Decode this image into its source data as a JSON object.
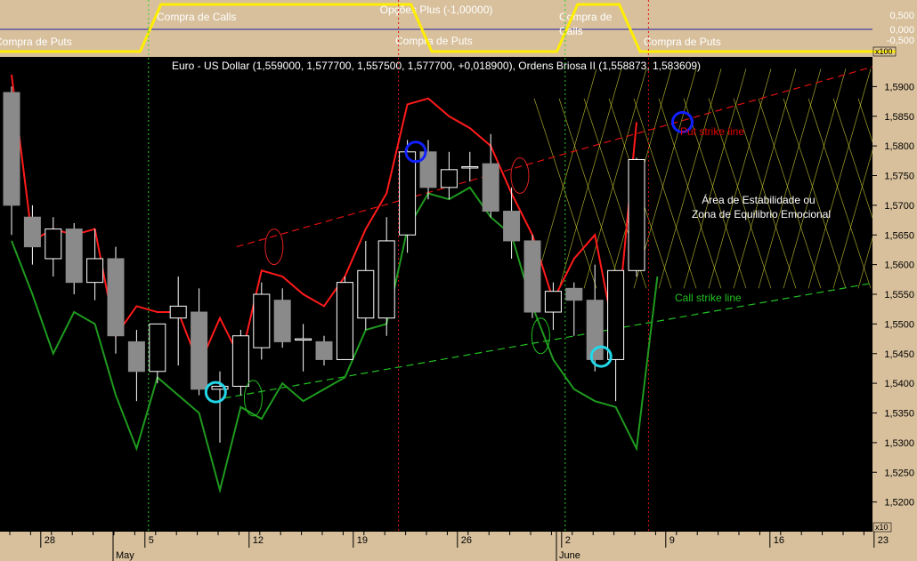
{
  "top_panel": {
    "title": "Opções Plus (-1,00000)",
    "labels": [
      {
        "text": "Compra de Puts"
      },
      {
        "text": "Compra de Calls"
      },
      {
        "text": "Compra de Puts"
      },
      {
        "text": "Compra de"
      },
      {
        "text": "Calls"
      },
      {
        "text": "Compra de Puts"
      }
    ],
    "y_ticks": [
      "0,500",
      "0,000",
      "-0,500"
    ],
    "unit": "x100",
    "signal": [
      {
        "from": 0,
        "to": 6,
        "value": -0.5
      },
      {
        "from": 7,
        "to": 19,
        "value": 0.5
      },
      {
        "from": 20,
        "to": 26,
        "value": -0.5
      },
      {
        "from": 27,
        "to": 29,
        "value": 0.5
      },
      {
        "from": 30,
        "to": 41,
        "value": -0.5
      }
    ]
  },
  "chart_data": {
    "type": "candlestick",
    "title": "Euro - US Dollar (1,559000, 1,577700, 1,557500, 1,577700, +0,018900), Ordens Briosa II (1,558873, 1,583609)",
    "ylim": [
      1.515,
      1.595
    ],
    "y_ticks": [
      "1,5900",
      "1,5850",
      "1,5800",
      "1,5750",
      "1,5700",
      "1,5650",
      "1,5600",
      "1,5550",
      "1,5500",
      "1,5450",
      "1,5400",
      "1,5350",
      "1,5300",
      "1,5250",
      "1,5200"
    ],
    "x_day_labels": [
      "28",
      "5",
      "12",
      "19",
      "26",
      "2",
      "9",
      "16",
      "23"
    ],
    "x_month_labels": [
      "May",
      "June"
    ],
    "x_unit": "x10",
    "candles": [
      {
        "o": 1.589,
        "h": 1.59,
        "l": 1.565,
        "c": 1.57
      },
      {
        "o": 1.568,
        "h": 1.57,
        "l": 1.56,
        "c": 1.563
      },
      {
        "o": 1.561,
        "h": 1.568,
        "l": 1.558,
        "c": 1.566
      },
      {
        "o": 1.566,
        "h": 1.567,
        "l": 1.555,
        "c": 1.557
      },
      {
        "o": 1.557,
        "h": 1.566,
        "l": 1.554,
        "c": 1.561
      },
      {
        "o": 1.561,
        "h": 1.563,
        "l": 1.545,
        "c": 1.548
      },
      {
        "o": 1.547,
        "h": 1.549,
        "l": 1.537,
        "c": 1.542
      },
      {
        "o": 1.542,
        "h": 1.55,
        "l": 1.54,
        "c": 1.55
      },
      {
        "o": 1.551,
        "h": 1.558,
        "l": 1.543,
        "c": 1.553
      },
      {
        "o": 1.552,
        "h": 1.556,
        "l": 1.538,
        "c": 1.539
      },
      {
        "o": 1.539,
        "h": 1.542,
        "l": 1.53,
        "c": 1.5395
      },
      {
        "o": 1.5395,
        "h": 1.549,
        "l": 1.538,
        "c": 1.548
      },
      {
        "o": 1.546,
        "h": 1.557,
        "l": 1.544,
        "c": 1.555
      },
      {
        "o": 1.554,
        "h": 1.556,
        "l": 1.546,
        "c": 1.547
      },
      {
        "o": 1.5475,
        "h": 1.55,
        "l": 1.542,
        "c": 1.5475
      },
      {
        "o": 1.547,
        "h": 1.548,
        "l": 1.543,
        "c": 1.544
      },
      {
        "o": 1.544,
        "h": 1.558,
        "l": 1.544,
        "c": 1.557
      },
      {
        "o": 1.551,
        "h": 1.564,
        "l": 1.549,
        "c": 1.559
      },
      {
        "o": 1.551,
        "h": 1.568,
        "l": 1.548,
        "c": 1.564
      },
      {
        "o": 1.565,
        "h": 1.581,
        "l": 1.562,
        "c": 1.579
      },
      {
        "o": 1.579,
        "h": 1.581,
        "l": 1.571,
        "c": 1.573
      },
      {
        "o": 1.573,
        "h": 1.579,
        "l": 1.571,
        "c": 1.576
      },
      {
        "o": 1.5765,
        "h": 1.579,
        "l": 1.574,
        "c": 1.5765
      },
      {
        "o": 1.577,
        "h": 1.582,
        "l": 1.568,
        "c": 1.569
      },
      {
        "o": 1.569,
        "h": 1.573,
        "l": 1.561,
        "c": 1.564
      },
      {
        "o": 1.564,
        "h": 1.565,
        "l": 1.551,
        "c": 1.552
      },
      {
        "o": 1.552,
        "h": 1.557,
        "l": 1.549,
        "c": 1.5555
      },
      {
        "o": 1.556,
        "h": 1.557,
        "l": 1.548,
        "c": 1.554
      },
      {
        "o": 1.554,
        "h": 1.56,
        "l": 1.542,
        "c": 1.544
      },
      {
        "o": 1.544,
        "h": 1.559,
        "l": 1.537,
        "c": 1.559
      },
      {
        "o": 1.559,
        "h": 1.578,
        "l": 1.558,
        "c": 1.5777
      }
    ],
    "series": [
      {
        "name": "Put strike line",
        "values": [
          1.592,
          1.564,
          1.566,
          1.565,
          1.566,
          1.548,
          1.553,
          1.552,
          1.552,
          1.543,
          1.551,
          1.544,
          1.559,
          1.558,
          1.555,
          1.553,
          1.558,
          1.566,
          1.572,
          1.587,
          1.588,
          1.585,
          1.583,
          1.58,
          1.572,
          1.565,
          1.554,
          1.561,
          1.565,
          1.547,
          1.584
        ]
      },
      {
        "name": "Call strike line",
        "values": [
          1.564,
          1.555,
          1.545,
          1.552,
          1.55,
          1.538,
          1.529,
          1.541,
          1.538,
          1.535,
          1.522,
          1.536,
          1.534,
          1.54,
          1.537,
          1.539,
          1.541,
          1.549,
          1.55,
          1.566,
          1.572,
          1.571,
          1.573,
          1.568,
          1.565,
          1.553,
          1.544,
          1.539,
          1.537,
          1.536,
          1.529,
          1.558
        ]
      }
    ],
    "trendlines": [
      {
        "name": "Put strike line",
        "from": [
          10.8,
          1.563
        ],
        "to": [
          41.5,
          1.5935
        ]
      },
      {
        "name": "Call strike line",
        "from": [
          10.2,
          1.5375
        ],
        "to": [
          41.5,
          1.557
        ]
      }
    ],
    "annotations": [
      {
        "text": "Put strike line",
        "color": "#e00000"
      },
      {
        "text": "Call strike line",
        "color": "#22c022"
      },
      {
        "text": "Área de Estabilidade ou"
      },
      {
        "text": "Zona de Equilibrio Emocional"
      }
    ],
    "zone_label": "Área de Estabilidade ou Zona de Equilibrio Emocional",
    "vertical_markers": [
      {
        "index": 7,
        "color": "#2bd02b"
      },
      {
        "index": 19,
        "color": "#e01010"
      },
      {
        "index": 27,
        "color": "#2bd02b"
      },
      {
        "index": 31,
        "color": "#e01010"
      }
    ],
    "circles": [
      {
        "index": 9.8,
        "value": 1.5385,
        "color": "#22d8e8"
      },
      {
        "index": 19.4,
        "value": 1.579,
        "color": "#1020ff"
      },
      {
        "index": 28.3,
        "value": 1.5445,
        "color": "#22d8e8"
      },
      {
        "index": 32.2,
        "value": 1.584,
        "color": "#1020ff"
      }
    ],
    "ellipses": [
      {
        "index": 12.6,
        "value": 1.563,
        "color": "#e02020"
      },
      {
        "index": 24.4,
        "value": 1.575,
        "color": "#e02020"
      },
      {
        "index": 11.6,
        "value": 1.5375,
        "color": "#22c022"
      },
      {
        "index": 25.4,
        "value": 1.548,
        "color": "#22c022"
      }
    ]
  }
}
